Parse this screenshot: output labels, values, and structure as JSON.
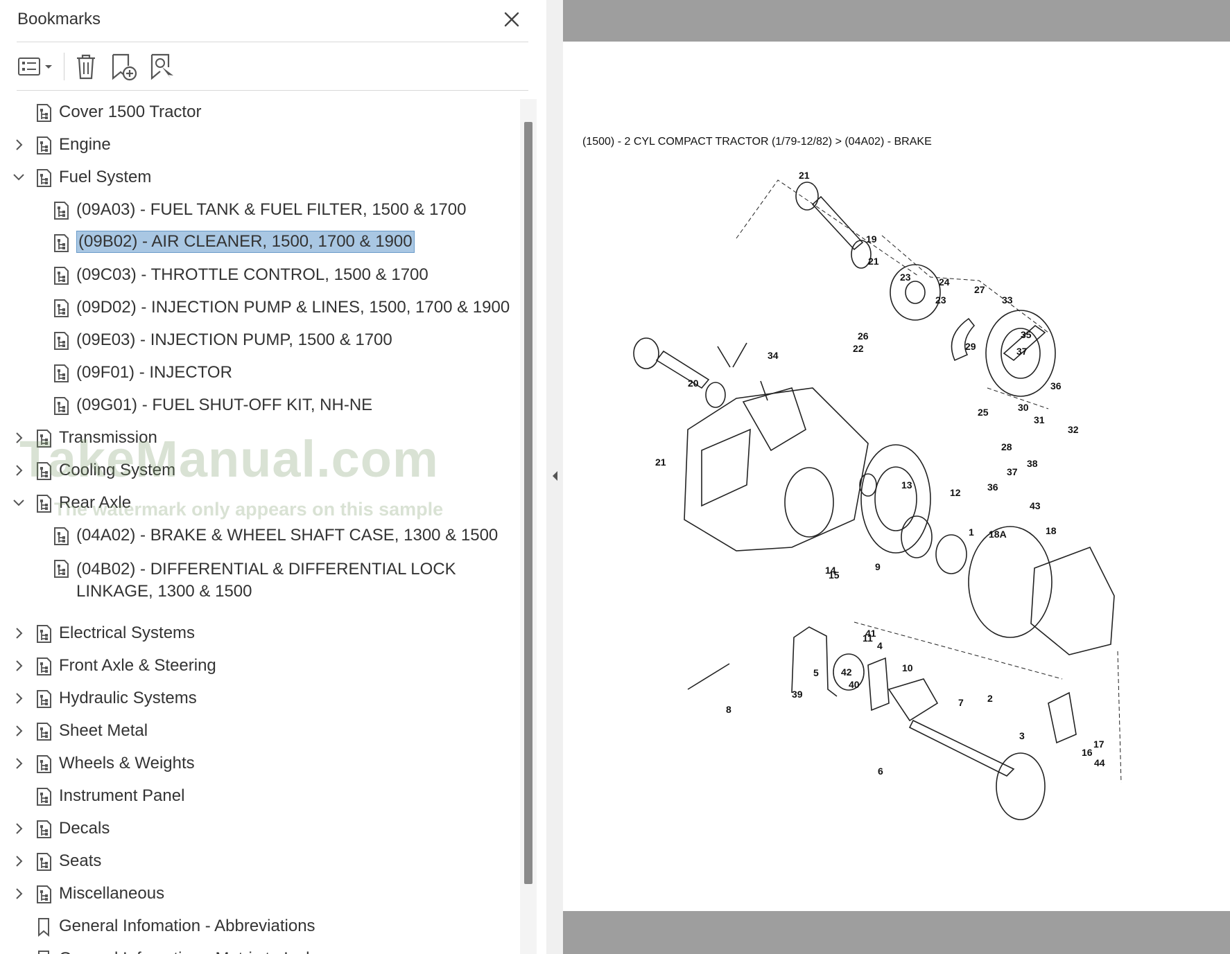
{
  "panel": {
    "title": "Bookmarks",
    "toolbar": {
      "options_icon": "list-options-icon",
      "delete_icon": "trash-icon",
      "new_bookmark_icon": "bookmark-add-icon",
      "new_bookmark_from_structure_icon": "bookmark-structure-icon"
    }
  },
  "tree": [
    {
      "label": "Cover 1500 Tractor",
      "level": 0,
      "expand": "none",
      "icon": "structure-icon"
    },
    {
      "label": "Engine",
      "level": 0,
      "expand": "collapsed",
      "icon": "structure-icon"
    },
    {
      "label": "Fuel System",
      "level": 0,
      "expand": "expanded",
      "icon": "structure-icon"
    },
    {
      "label": "(09A03) - FUEL TANK & FUEL FILTER, 1500 & 1700",
      "level": 1,
      "expand": "none",
      "icon": "structure-icon"
    },
    {
      "label": "(09B02) - AIR CLEANER, 1500, 1700 & 1900",
      "level": 1,
      "expand": "none",
      "icon": "structure-icon",
      "selected": true
    },
    {
      "label": "(09C03) - THROTTLE CONTROL, 1500 & 1700",
      "level": 1,
      "expand": "none",
      "icon": "structure-icon"
    },
    {
      "label": "(09D02) - INJECTION PUMP & LINES, 1500, 1700 & 1900",
      "level": 1,
      "expand": "none",
      "icon": "structure-icon"
    },
    {
      "label": "(09E03) - INJECTION PUMP, 1500 & 1700",
      "level": 1,
      "expand": "none",
      "icon": "structure-icon"
    },
    {
      "label": "(09F01) - INJECTOR",
      "level": 1,
      "expand": "none",
      "icon": "structure-icon"
    },
    {
      "label": "(09G01) - FUEL SHUT-OFF KIT, NH-NE",
      "level": 1,
      "expand": "none",
      "icon": "structure-icon"
    },
    {
      "label": "Transmission",
      "level": 0,
      "expand": "collapsed",
      "icon": "structure-icon"
    },
    {
      "label": "Cooling System",
      "level": 0,
      "expand": "collapsed",
      "icon": "structure-icon"
    },
    {
      "label": "Rear Axle",
      "level": 0,
      "expand": "expanded",
      "icon": "structure-icon"
    },
    {
      "label": "(04A02) - BRAKE & WHEEL SHAFT CASE, 1300 & 1500",
      "level": 1,
      "expand": "none",
      "icon": "structure-icon"
    },
    {
      "label": "(04B02) - DIFFERENTIAL & DIFFERENTIAL LOCK LINKAGE, 1300 & 1500",
      "level": 1,
      "expand": "none",
      "icon": "structure-icon",
      "wrap": true
    },
    {
      "label": "Electrical Systems",
      "level": 0,
      "expand": "collapsed",
      "icon": "structure-icon"
    },
    {
      "label": "Front Axle & Steering",
      "level": 0,
      "expand": "collapsed",
      "icon": "structure-icon"
    },
    {
      "label": "Hydraulic Systems",
      "level": 0,
      "expand": "collapsed",
      "icon": "structure-icon"
    },
    {
      "label": "Sheet Metal",
      "level": 0,
      "expand": "collapsed",
      "icon": "structure-icon"
    },
    {
      "label": "Wheels & Weights",
      "level": 0,
      "expand": "collapsed",
      "icon": "structure-icon"
    },
    {
      "label": "Instrument Panel",
      "level": 0,
      "expand": "none",
      "icon": "structure-icon"
    },
    {
      "label": "Decals",
      "level": 0,
      "expand": "collapsed",
      "icon": "structure-icon"
    },
    {
      "label": "Seats",
      "level": 0,
      "expand": "collapsed",
      "icon": "structure-icon"
    },
    {
      "label": "Miscellaneous",
      "level": 0,
      "expand": "collapsed",
      "icon": "structure-icon"
    },
    {
      "label": "General Infomation - Abbreviations",
      "level": 0,
      "expand": "none",
      "icon": "bookmark-icon"
    },
    {
      "label": "General Infomation - Metric to Inches",
      "level": 0,
      "expand": "none",
      "icon": "bookmark-icon"
    }
  ],
  "watermark": {
    "main": "TakeManual.com",
    "note": "The watermark only appears on this sample"
  },
  "document": {
    "heading": "(1500) - 2 CYL COMPACT TRACTOR (1/79-12/82) > (04A02) - BRAKE",
    "callouts": [
      "21",
      "19",
      "21",
      "23",
      "24",
      "23",
      "27",
      "33",
      "35",
      "22",
      "26",
      "29",
      "37",
      "36",
      "34",
      "20",
      "25",
      "30",
      "31",
      "32",
      "28",
      "38",
      "37",
      "36",
      "43",
      "21",
      "13",
      "12",
      "18A",
      "18",
      "1",
      "9",
      "14",
      "15",
      "11",
      "10",
      "41",
      "42",
      "7",
      "5",
      "4",
      "40",
      "39",
      "8",
      "2",
      "3",
      "16",
      "17",
      "44",
      "6"
    ]
  },
  "colors": {
    "selection_fill": "#a9c7e3",
    "selection_border": "#6a9bc9",
    "gutter_gray": "#9e9e9e",
    "scroll_thumb": "#8a8a8a",
    "watermark": "#b5c8a8"
  }
}
